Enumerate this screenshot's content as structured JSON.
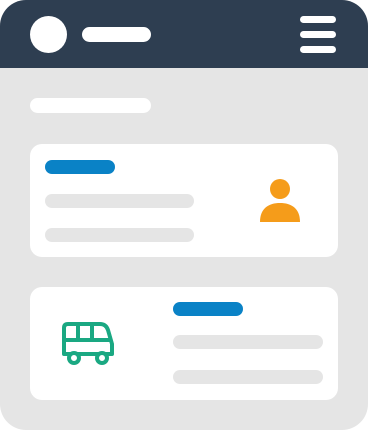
{
  "colors": {
    "header_bg": "#2e3e51",
    "body_bg": "#e5e5e5",
    "card_bg": "#ffffff",
    "accent_blue": "#0a82c6",
    "user_icon": "#f59c1a",
    "bus_icon": "#1aa882",
    "placeholder_line": "#e5e5e5"
  },
  "header": {
    "avatar_icon": "avatar-circle",
    "menu_icon": "hamburger-icon"
  },
  "cards": [
    {
      "icon": "user-icon"
    },
    {
      "icon": "bus-icon"
    }
  ]
}
